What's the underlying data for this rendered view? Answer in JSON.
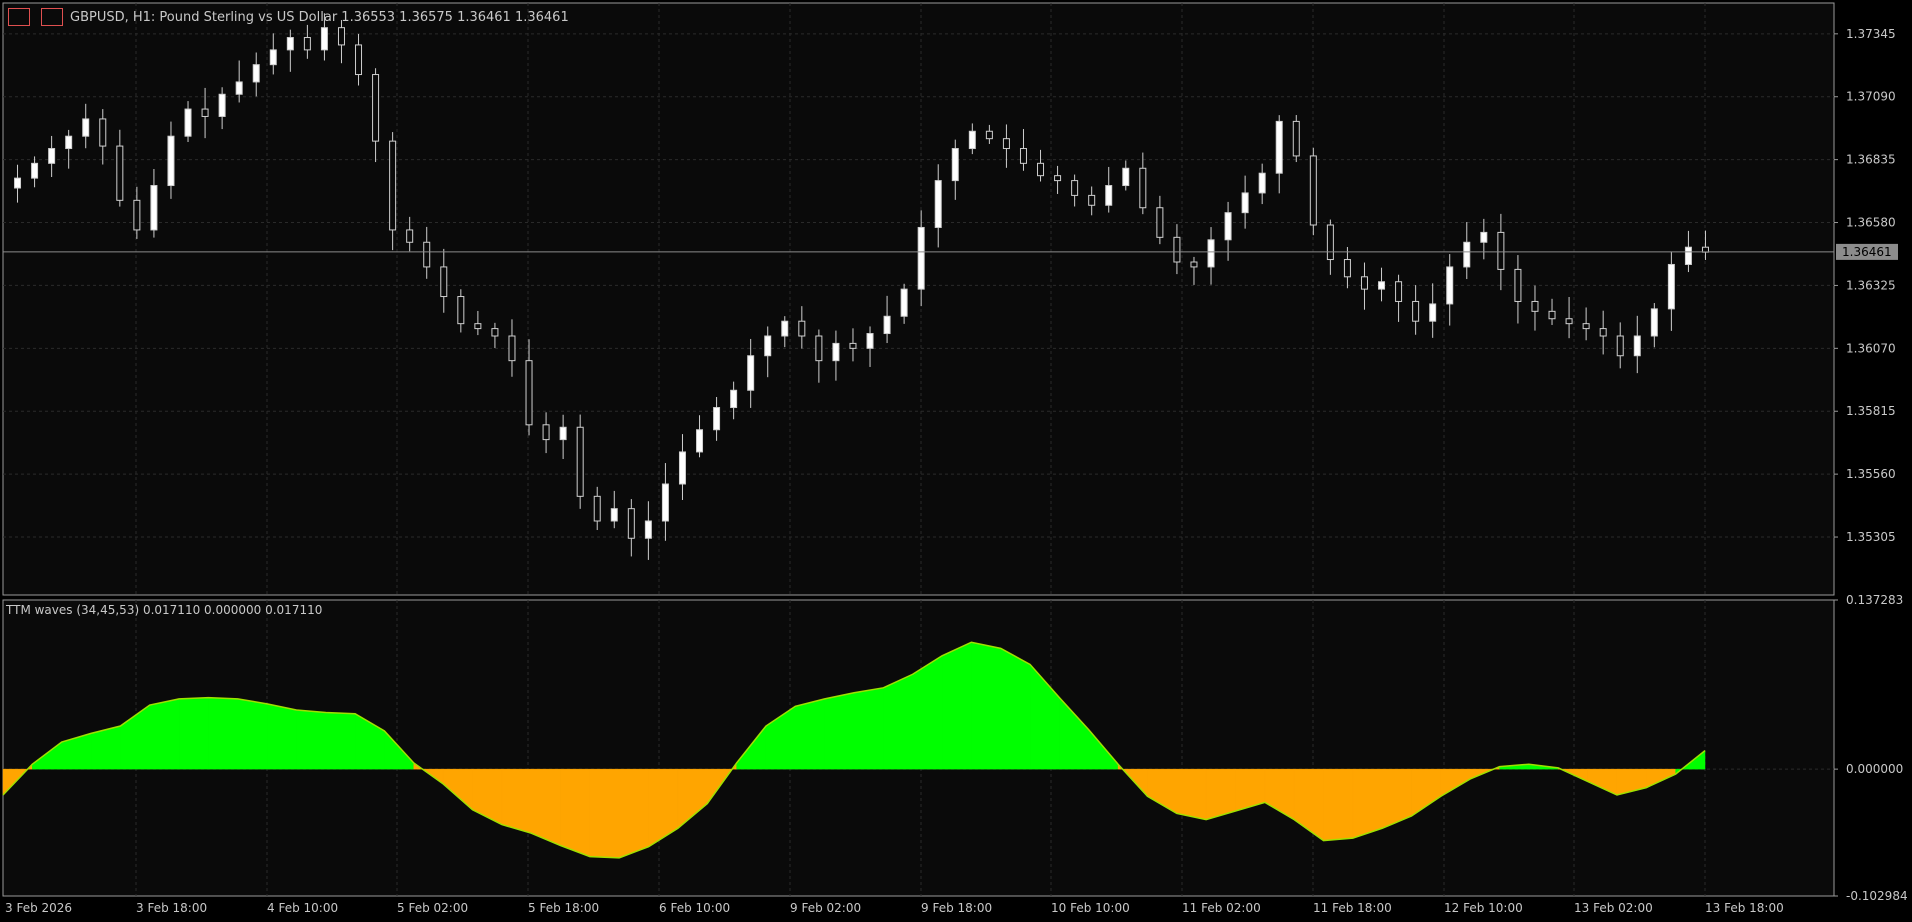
{
  "header": {
    "symbol_info": "GBPUSD, H1:  Pound Sterling vs US Dollar  1.36553 1.36575 1.36461 1.36461"
  },
  "indicator": {
    "label": "TTM waves (34,45,53) 0.017110 0.000000 0.017110"
  },
  "price_axis": {
    "ticks": [
      "1.37345",
      "1.37090",
      "1.36835",
      "1.36580",
      "1.36325",
      "1.36070",
      "1.35815",
      "1.35560",
      "1.35305"
    ],
    "current_price": "1.36461"
  },
  "indicator_axis": {
    "ticks": [
      "0.137283",
      "0.000000",
      "-0.102984"
    ]
  },
  "time_axis": {
    "labels": [
      "3 Feb 2026",
      "3 Feb 18:00",
      "4 Feb 10:00",
      "5 Feb 02:00",
      "5 Feb 18:00",
      "6 Feb 10:00",
      "9 Feb 02:00",
      "9 Feb 18:00",
      "10 Feb 10:00",
      "11 Feb 02:00",
      "11 Feb 18:00",
      "12 Feb 10:00",
      "13 Feb 02:00",
      "13 Feb 18:00"
    ]
  },
  "chart_data": [
    {
      "type": "candlestick",
      "title": "GBPUSD, H1",
      "ylim": [
        1.3507,
        1.3747
      ],
      "current_price": 1.36461,
      "close_series": [
        1.3676,
        1.3682,
        1.3688,
        1.3693,
        1.37,
        1.3689,
        1.3667,
        1.3655,
        1.3673,
        1.3693,
        1.3704,
        1.3701,
        1.371,
        1.3715,
        1.3722,
        1.3728,
        1.3733,
        1.3728,
        1.3737,
        1.373,
        1.3718,
        1.3691,
        1.3655,
        1.365,
        1.364,
        1.3628,
        1.3617,
        1.3615,
        1.3612,
        1.3602,
        1.3576,
        1.357,
        1.3575,
        1.3547,
        1.3537,
        1.3542,
        1.353,
        1.3537,
        1.3552,
        1.3565,
        1.3574,
        1.3583,
        1.359,
        1.3604,
        1.3612,
        1.3618,
        1.3612,
        1.3602,
        1.3609,
        1.3607,
        1.3613,
        1.362,
        1.3631,
        1.3656,
        1.3675,
        1.3688,
        1.3695,
        1.3692,
        1.3688,
        1.3682,
        1.3677,
        1.3675,
        1.3669,
        1.3665,
        1.3673,
        1.368,
        1.3664,
        1.3652,
        1.3642,
        1.364,
        1.3651,
        1.3662,
        1.367,
        1.3678,
        1.3699,
        1.3685,
        1.3657,
        1.3643,
        1.3636,
        1.3631,
        1.3634,
        1.3626,
        1.3618,
        1.3625,
        1.364,
        1.365,
        1.3654,
        1.3639,
        1.3626,
        1.3622,
        1.3619,
        1.3617,
        1.3615,
        1.3612,
        1.3604,
        1.3612,
        1.3623,
        1.3641,
        1.3648,
        1.3646
      ]
    },
    {
      "type": "area",
      "title": "TTM waves (34,45,53)",
      "ylim": [
        -0.102984,
        0.137283
      ],
      "values": [
        -0.021,
        0.004,
        0.022,
        0.029,
        0.035,
        0.052,
        0.057,
        0.058,
        0.057,
        0.053,
        0.048,
        0.046,
        0.045,
        0.031,
        0.005,
        -0.012,
        -0.033,
        -0.045,
        -0.052,
        -0.062,
        -0.071,
        -0.072,
        -0.063,
        -0.048,
        -0.028,
        0.005,
        0.035,
        0.051,
        0.057,
        0.062,
        0.066,
        0.077,
        0.092,
        0.103,
        0.098,
        0.085,
        0.058,
        0.032,
        0.004,
        -0.022,
        -0.036,
        -0.041,
        -0.034,
        -0.027,
        -0.041,
        -0.058,
        -0.056,
        -0.048,
        -0.038,
        -0.022,
        -0.008,
        0.002,
        0.004,
        0.001,
        -0.01,
        -0.021,
        -0.015,
        -0.004,
        0.015
      ],
      "last_value": 0.01711
    }
  ]
}
